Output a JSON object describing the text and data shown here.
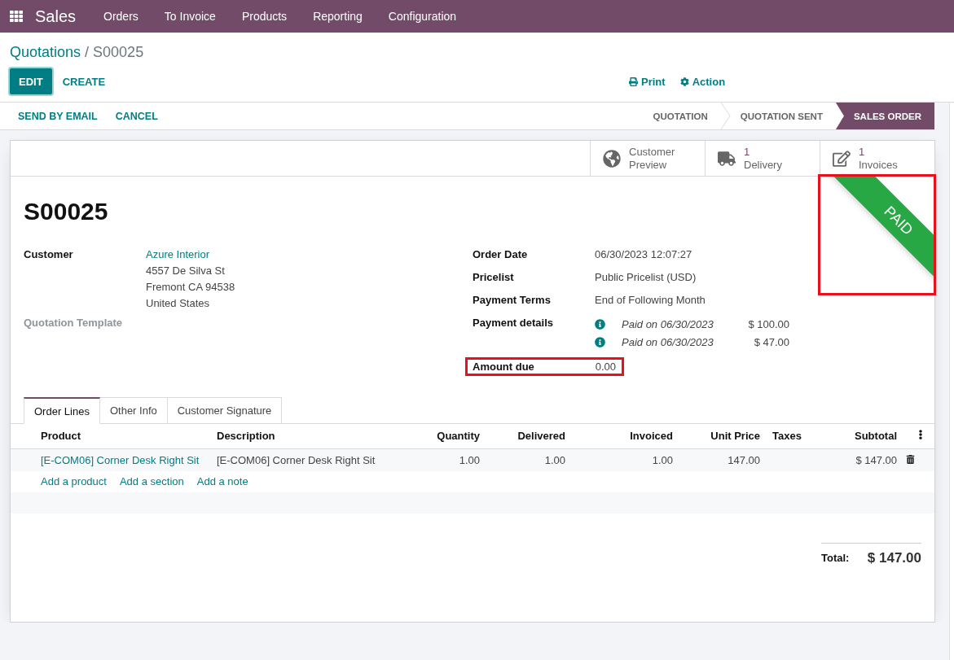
{
  "nav": {
    "app": "Sales",
    "menu": [
      "Orders",
      "To Invoice",
      "Products",
      "Reporting",
      "Configuration"
    ]
  },
  "breadcrumb": {
    "parent": "Quotations",
    "separator": "/",
    "current": "S00025"
  },
  "control_buttons": [
    {
      "label": "EDIT",
      "kind": "primary"
    },
    {
      "label": "CREATE",
      "kind": "link"
    }
  ],
  "toolbar_actions": [
    {
      "label": "Print",
      "kind": "print"
    },
    {
      "label": "Action",
      "kind": "gear"
    }
  ],
  "header_buttons": [
    "SEND BY EMAIL",
    "CANCEL"
  ],
  "status_steps": [
    {
      "label": "QUOTATION",
      "selected": false
    },
    {
      "label": "QUOTATION SENT",
      "selected": false
    },
    {
      "label": "SALES ORDER",
      "selected": true
    }
  ],
  "smart_buttons": [
    {
      "kind": "text",
      "label": "Customer Preview"
    },
    {
      "kind": "stat",
      "value": "1",
      "label": "Delivery"
    },
    {
      "kind": "stat",
      "value": "1",
      "label": "Invoices"
    }
  ],
  "ribbon": {
    "label": "PAID",
    "highlighted": true
  },
  "title": "S00025",
  "left_fields": [
    {
      "kind": "partner",
      "label": "Customer",
      "name": "Azure Interior",
      "address": [
        "4557 De Silva St",
        "Fremont CA 94538",
        "United States"
      ]
    },
    {
      "kind": "empty",
      "label": "Quotation Template"
    }
  ],
  "right_fields": [
    {
      "kind": "text",
      "label": "Order Date",
      "value": "06/30/2023 12:07:27"
    },
    {
      "kind": "text",
      "label": "Pricelist",
      "value": "Public Pricelist (USD)"
    },
    {
      "kind": "text",
      "label": "Payment Terms",
      "value": "End of Following Month"
    },
    {
      "kind": "payments",
      "label": "Payment details",
      "payments": [
        {
          "text": "Paid on 06/30/2023",
          "amount": "$ 100.00"
        },
        {
          "text": "Paid on 06/30/2023",
          "amount": "$ 47.00"
        }
      ]
    }
  ],
  "amount_due": {
    "label": "Amount due",
    "value": "0.00",
    "highlighted": true
  },
  "tabs": [
    {
      "label": "Order Lines",
      "selected": true
    },
    {
      "label": "Other Info",
      "selected": false
    },
    {
      "label": "Customer Signature",
      "selected": false
    }
  ],
  "table": {
    "columns": [
      {
        "label": "Product",
        "kind": "text"
      },
      {
        "label": "Description",
        "kind": "text"
      },
      {
        "label": "Quantity",
        "kind": "number"
      },
      {
        "label": "Delivered",
        "kind": "number"
      },
      {
        "label": "Invoiced",
        "kind": "number"
      },
      {
        "label": "Unit Price",
        "kind": "number"
      },
      {
        "label": "Taxes",
        "kind": "text"
      },
      {
        "label": "Subtotal",
        "kind": "number"
      }
    ],
    "rows": [
      {
        "product": "[E-COM06] Corner Desk Right Sit",
        "description": "[E-COM06] Corner Desk Right Sit",
        "quantity": "1.00",
        "delivered": "1.00",
        "invoiced": "1.00",
        "unit_price": "147.00",
        "subtotal": "$ 147.00"
      }
    ]
  },
  "add_links": [
    "Add a product",
    "Add a section",
    "Add a note"
  ],
  "total": {
    "label": "Total:",
    "value": "$ 147.00"
  }
}
